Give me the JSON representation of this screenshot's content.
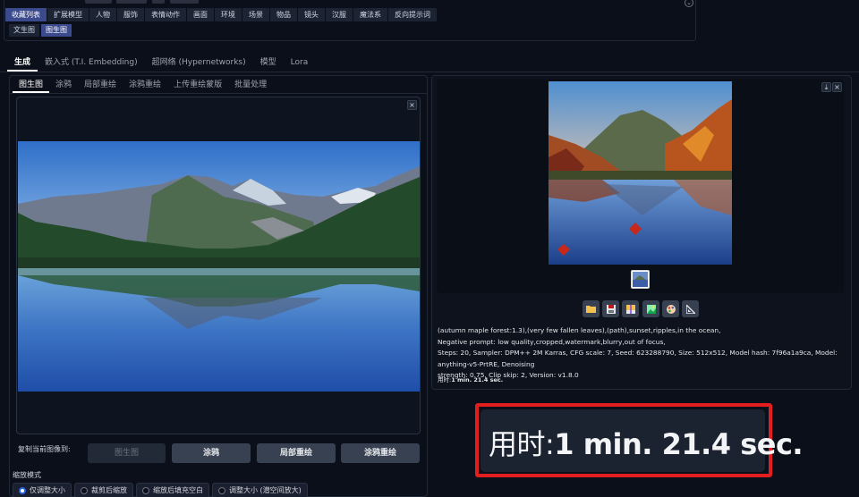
{
  "favorites_bar": {
    "tabs": [
      "收藏列表",
      "扩展模型",
      "人物",
      "服饰",
      "表情动作",
      "画面",
      "环境",
      "场景",
      "物品",
      "镜头",
      "汉服",
      "魔法系",
      "反向提示词"
    ],
    "active_index": 0,
    "sub_tabs": [
      "文生图",
      "图生图"
    ],
    "sub_active_index": 1
  },
  "main_tabs": {
    "items": [
      "生成",
      "嵌入式 (T.I. Embedding)",
      "超网络 (Hypernetworks)",
      "模型",
      "Lora"
    ],
    "active_index": 0
  },
  "img2img_tabs": {
    "items": [
      "图生图",
      "涂鸦",
      "局部重绘",
      "涂鸦重绘",
      "上传重绘蒙版",
      "批量处理"
    ],
    "active_index": 0
  },
  "copy_to": {
    "label": "复制当前图像到:",
    "buttons": [
      "图生图",
      "涂鸦",
      "局部重绘",
      "涂鸦重绘"
    ]
  },
  "resize_mode": {
    "label": "缩放模式",
    "options": [
      "仅调整大小",
      "裁剪后缩放",
      "缩放后填充空白",
      "调整大小 (潜空间放大)"
    ],
    "selected_index": 0
  },
  "close_glyph": "×",
  "download_glyph": "⤓",
  "output": {
    "info_lines": [
      "(autumn maple forest:1.3),(very few fallen leaves),(path),sunset,ripples,in the ocean,",
      "Negative prompt: low quality,cropped,watermark,blurry,out of focus,",
      "Steps: 20, Sampler: DPM++ 2M Karras, CFG scale: 7, Seed: 623288790, Size: 512x512, Model hash: 7f96a1a9ca, Model: anything-v5-PrtRE, Denoising",
      "strength: 0.75, Clip skip: 2, Version: v1.8.0"
    ],
    "time_label": "用时:",
    "time_value": "1 min. 21.4 sec.",
    "tool_icons": [
      "folder-icon",
      "save-icon",
      "zip-icon",
      "send-to-img2img-icon",
      "send-to-inpaint-icon",
      "send-to-extras-icon"
    ]
  },
  "zoom_callout": {
    "label": "用时:",
    "value": "1 min. 21.4 sec."
  },
  "colors": {
    "background": "#0b0f19",
    "active_tab": "#3b4a8c",
    "button": "#374151",
    "highlight_border": "#e11d1d"
  }
}
